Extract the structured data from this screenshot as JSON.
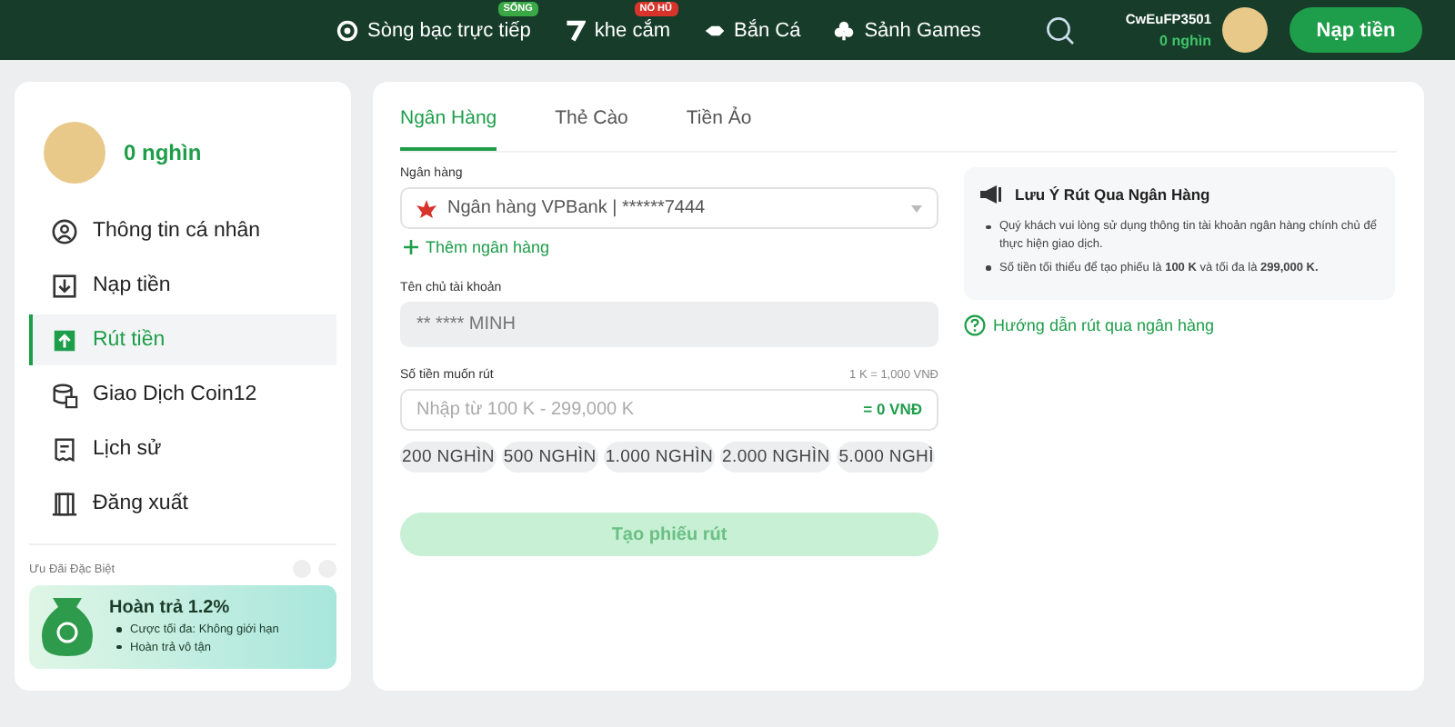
{
  "header": {
    "nav": [
      {
        "label": "Sòng bạc trực tiếp",
        "badge": "SỐNG"
      },
      {
        "label": "khe cắm",
        "badge": "NỔ HŨ"
      },
      {
        "label": "Bắn Cá"
      },
      {
        "label": "Sảnh Games"
      }
    ],
    "username": "CwEuFP3501",
    "balance": "0 nghìn",
    "deposit_button": "Nạp tiền"
  },
  "sidebar": {
    "balance": "0 nghìn",
    "items": [
      {
        "label": "Thông tin cá nhân",
        "selected": false
      },
      {
        "label": "Nạp tiền",
        "selected": false
      },
      {
        "label": "Rút tiền",
        "selected": true
      },
      {
        "label": "Giao Dịch Coin12",
        "selected": false
      },
      {
        "label": "Lịch sử",
        "selected": false
      },
      {
        "label": "Đăng xuất",
        "selected": false
      }
    ],
    "promo": {
      "title": "Ưu Đãi Đặc Biệt",
      "heading": "Hoàn trả 1.2%",
      "bullets": [
        "Cược tối đa: Không giới hạn",
        "Hoàn trả vô tận"
      ]
    }
  },
  "tabs": [
    {
      "label": "Ngân Hàng",
      "selected": true
    },
    {
      "label": "Thẻ Cào",
      "selected": false
    },
    {
      "label": "Tiền Ảo",
      "selected": false
    }
  ],
  "form": {
    "bank_label": "Ngân hàng",
    "bank_value": "Ngân hàng VPBank | ******7444",
    "add_bank": "Thêm ngân hàng",
    "holder_label": "Tên chủ tài khoản",
    "holder_value": "** **** MINH",
    "amount_label": "Số tiền muốn rút",
    "rate": "1 K = 1,000 VNĐ",
    "amount_placeholder": "Nhập từ 100 K - 299,000 K",
    "amount_converted": "= 0 VNĐ",
    "chips": [
      "200 NGHÌN",
      "500 NGHÌN",
      "1.000 NGHÌN",
      "2.000 NGHÌN",
      "5.000 NGHÌ"
    ],
    "submit": "Tạo phiếu rút",
    "submit_disabled": true
  },
  "notice": {
    "title": "Lưu Ý Rút Qua Ngân Hàng",
    "items": [
      "Quý khách vui lòng sử dụng thông tin tài khoản ngân hàng chính chủ để thực hiện giao dịch.",
      "Số tiền tối thiểu để tạo phiếu là **100 K** và tối đa là **299,000 K.**"
    ],
    "help_link": "Hướng dẫn rút qua ngân hàng"
  }
}
